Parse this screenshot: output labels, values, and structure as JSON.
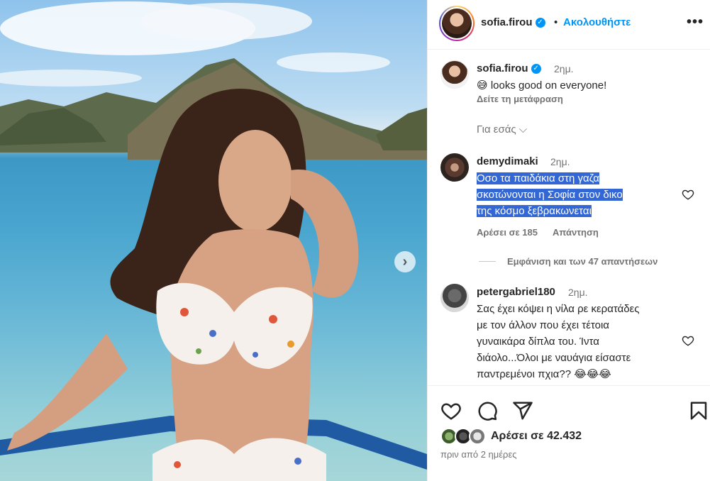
{
  "post": {
    "username": "sofia.firou",
    "follow_label": "Ακολουθήστε",
    "separator": "•",
    "more_label": "•••",
    "carousel_next": "›"
  },
  "caption": {
    "username": "sofia.firou",
    "time": "2ημ.",
    "emoji": "😅",
    "text": "looks good on everyone!",
    "translate": "Δείτε τη μετάφραση",
    "for_you": "Για εσάς ⌵"
  },
  "comments": [
    {
      "username": "demydimaki",
      "time": "2ημ.",
      "lines": [
        "Οσο τα παιδάκια στη γαζα",
        "σκοτώνονται η Σοφία στον δικο",
        "της κόσμο ξεβρακωνεται"
      ],
      "likes": "Αρέσει σε 185",
      "reply": "Απάντηση",
      "view_replies": "Εμφάνιση και των 47 απαντήσεων"
    },
    {
      "username": "petergabriel180",
      "time": "2ημ.",
      "lines": [
        "Σας έχει κόψει η νίλα ρε κερατάδες",
        "με τον άλλον που έχει τέτοια",
        "γυναικάρα δίπλα του. Ίντα",
        "διάολο...Όλοι με ναυάγια είσαστε",
        "παντρεμένοι πχια?? 😂😂😂"
      ]
    }
  ],
  "footer": {
    "likes": "Αρέσει σε 42.432",
    "time_ago": "πριν από 2 ημέρες"
  },
  "colors": {
    "accent": "#0095f6",
    "highlight": "#3367d6",
    "secondary_text": "#737373"
  },
  "icons": [
    "verified-badge-icon",
    "heart-icon",
    "comment-icon",
    "share-icon",
    "bookmark-icon",
    "chevron-right-icon",
    "more-options-icon"
  ]
}
